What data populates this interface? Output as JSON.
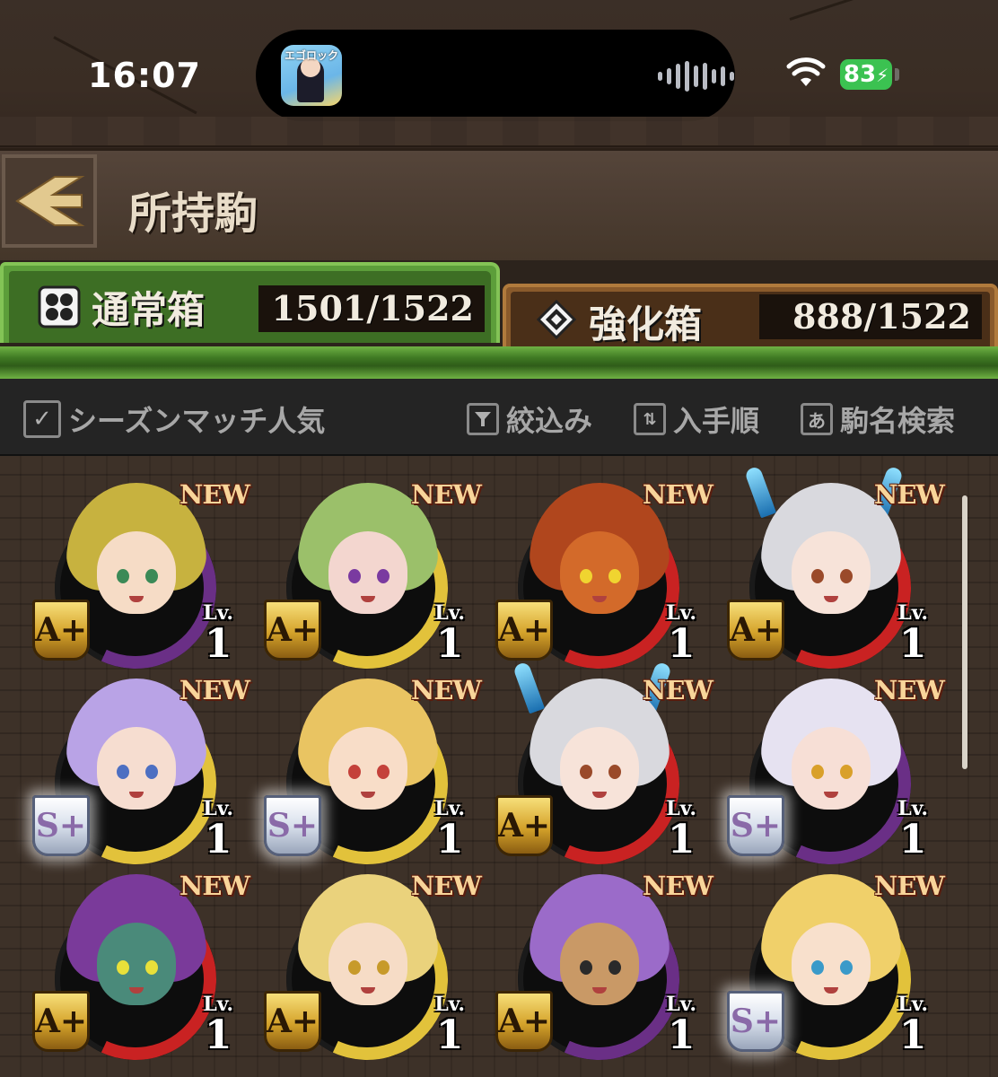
{
  "status_bar": {
    "time": "16:07",
    "battery": "83",
    "app_icon_text": "エゴロック"
  },
  "header": {
    "title": "所持駒"
  },
  "tabs": [
    {
      "label": "通常箱",
      "count": "1501/1522",
      "active": true
    },
    {
      "label": "強化箱",
      "count": "888/1522",
      "active": false
    }
  ],
  "filter_bar": {
    "season_checkbox": "シーズンマッチ人気",
    "filter": "絞込み",
    "sort": "入手順",
    "search_badge": "あ",
    "search": "駒名検索"
  },
  "pieces": [
    {
      "new": "NEW",
      "rank": "A+",
      "rank_tier": "gold",
      "lv_label": "Lv.",
      "level": "1",
      "hair": "#c7b23f",
      "skin": "#f6dcc6",
      "eye": "#3b8a57",
      "arc": "#6a2f86"
    },
    {
      "new": "NEW",
      "rank": "A+",
      "rank_tier": "gold",
      "lv_label": "Lv.",
      "level": "1",
      "hair": "#9bc06a",
      "skin": "#f3d6cf",
      "eye": "#7a3aa0",
      "arc": "#e2c23b"
    },
    {
      "new": "NEW",
      "rank": "A+",
      "rank_tier": "gold",
      "lv_label": "Lv.",
      "level": "1",
      "hair": "#b0461d",
      "skin": "#d36a2a",
      "eye": "#f0d430",
      "arc": "#c92222"
    },
    {
      "new": "NEW",
      "rank": "A+",
      "rank_tier": "gold",
      "lv_label": "Lv.",
      "level": "1",
      "hair": "#d9d9de",
      "skin": "#f7e3d9",
      "eye": "#9a4a2a",
      "arc": "#c92222"
    },
    {
      "new": "NEW",
      "rank": "S+",
      "rank_tier": "silver",
      "lv_label": "Lv.",
      "level": "1",
      "hair": "#b9a3e6",
      "skin": "#f6ddd0",
      "eye": "#4d6fc2",
      "arc": "#e2c23b"
    },
    {
      "new": "NEW",
      "rank": "S+",
      "rank_tier": "silver",
      "lv_label": "Lv.",
      "level": "1",
      "hair": "#e9c462",
      "skin": "#f8ddc8",
      "eye": "#c4413a",
      "arc": "#e2c23b"
    },
    {
      "new": "NEW",
      "rank": "A+",
      "rank_tier": "gold",
      "lv_label": "Lv.",
      "level": "1",
      "hair": "#d9d9de",
      "skin": "#f7e3d9",
      "eye": "#9a4a2a",
      "arc": "#c92222"
    },
    {
      "new": "NEW",
      "rank": "S+",
      "rank_tier": "silver",
      "lv_label": "Lv.",
      "level": "1",
      "hair": "#e6e2f1",
      "skin": "#f7dfd6",
      "eye": "#d9a02a",
      "arc": "#6a2f86"
    },
    {
      "new": "NEW",
      "rank": "A+",
      "rank_tier": "gold",
      "lv_label": "Lv.",
      "level": "1",
      "hair": "#7a3a9a",
      "skin": "#4a8a7a",
      "eye": "#e8e03a",
      "arc": "#c92222"
    },
    {
      "new": "NEW",
      "rank": "A+",
      "rank_tier": "gold",
      "lv_label": "Lv.",
      "level": "1",
      "hair": "#ead27c",
      "skin": "#f6dcc6",
      "eye": "#c79a2a",
      "arc": "#e2c23b"
    },
    {
      "new": "NEW",
      "rank": "A+",
      "rank_tier": "gold",
      "lv_label": "Lv.",
      "level": "1",
      "hair": "#9b6bc9",
      "skin": "#c99966",
      "eye": "#2a2a2a",
      "arc": "#6a2f86"
    },
    {
      "new": "NEW",
      "rank": "S+",
      "rank_tier": "silver",
      "lv_label": "Lv.",
      "level": "1",
      "hair": "#f0d06a",
      "skin": "#f8e0cc",
      "eye": "#3a9ac9",
      "arc": "#e2c23b"
    }
  ]
}
